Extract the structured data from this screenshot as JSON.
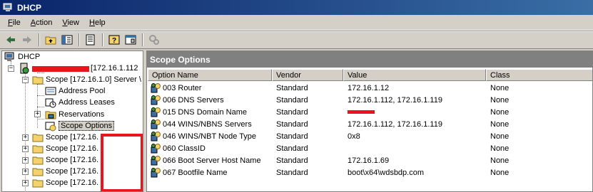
{
  "window": {
    "title": "DHCP"
  },
  "menu": [
    {
      "id": "file",
      "label": "File",
      "mnemonic": "F",
      "rest": "ile"
    },
    {
      "id": "action",
      "label": "Action",
      "mnemonic": "A",
      "rest": "ction"
    },
    {
      "id": "view",
      "label": "View",
      "mnemonic": "V",
      "rest": "iew"
    },
    {
      "id": "help",
      "label": "Help",
      "mnemonic": "H",
      "rest": "elp"
    }
  ],
  "toolbar": {
    "buttons": [
      "back-arrow-icon",
      "forward-arrow-icon",
      "up-folder-icon",
      "show-hide-tree-icon",
      "export-list-icon",
      "help-icon",
      "properties-icon",
      "server-action-icon"
    ]
  },
  "tree": {
    "root": "DHCP",
    "server": "[172.16.1.112",
    "scope": "Scope [172.16.1.0] Server \\",
    "scope_children": {
      "address_pool": "Address Pool",
      "address_leases": "Address Leases",
      "reservations": "Reservations",
      "scope_options": "Scope Options"
    },
    "other_scopes": [
      "Scope [172.16.",
      "Scope [172.16.",
      "Scope [172.16.",
      "Scope [172.16.",
      "Scope [172.16."
    ]
  },
  "details": {
    "title": "Scope Options",
    "columns": {
      "name": "Option Name",
      "vendor": "Vendor",
      "value": "Value",
      "class": "Class"
    },
    "rows": [
      {
        "name": "003 Router",
        "vendor": "Standard",
        "value": "172.16.1.12",
        "class": "None",
        "redacted": false
      },
      {
        "name": "006 DNS Servers",
        "vendor": "Standard",
        "value": "172.16.1.112, 172.16.1.119",
        "class": "None",
        "redacted": false
      },
      {
        "name": "015 DNS Domain Name",
        "vendor": "Standard",
        "value": "",
        "class": "None",
        "redacted": true
      },
      {
        "name": "044 WINS/NBNS Servers",
        "vendor": "Standard",
        "value": "172.16.1.112, 172.16.1.119",
        "class": "None",
        "redacted": false
      },
      {
        "name": "046 WINS/NBT Node Type",
        "vendor": "Standard",
        "value": "0x8",
        "class": "None",
        "redacted": false
      },
      {
        "name": "060 ClassID",
        "vendor": "Standard",
        "value": "",
        "class": "None",
        "redacted": false
      },
      {
        "name": "066 Boot Server Host Name",
        "vendor": "Standard",
        "value": "172.16.1.69",
        "class": "None",
        "redacted": false
      },
      {
        "name": "067 Bootfile Name",
        "vendor": "Standard",
        "value": "boot\\x64\\wdsbdp.com",
        "class": "None",
        "redacted": false
      }
    ]
  },
  "colors": {
    "redaction": "#e8141e",
    "title_bar": "#0a246a",
    "pane_header": "#808080"
  }
}
